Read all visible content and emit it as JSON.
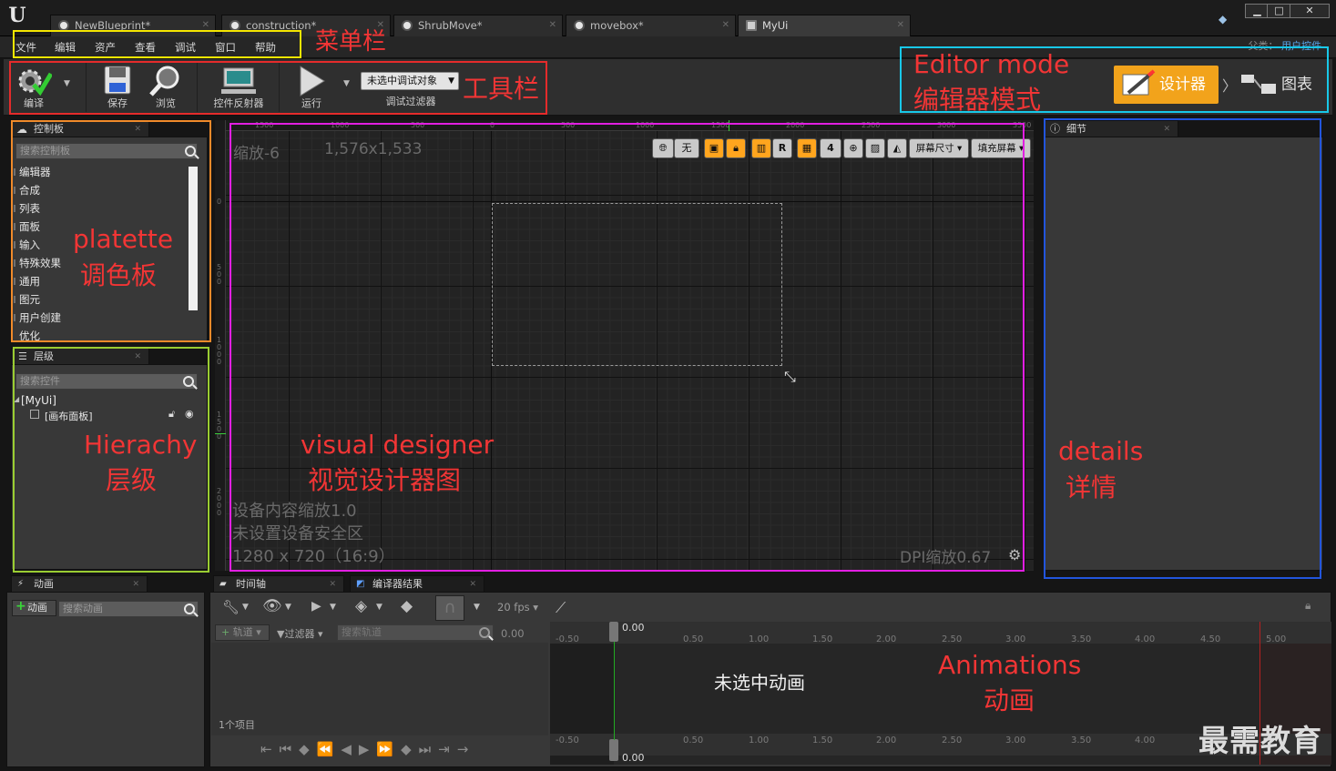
{
  "tabs": [
    {
      "label": "NewBlueprint*"
    },
    {
      "label": "construction*"
    },
    {
      "label": "ShrubMove*"
    },
    {
      "label": "movebox*"
    },
    {
      "label": "MyUi"
    }
  ],
  "menu": [
    "文件",
    "编辑",
    "资产",
    "查看",
    "调试",
    "窗口",
    "帮助"
  ],
  "breadcrumb": {
    "prefix": "父类：",
    "parent": "用户控件"
  },
  "toolbar": {
    "compile": "编译",
    "save": "保存",
    "browse": "浏览",
    "reflector": "控件反射器",
    "run": "运行",
    "debug_select": "未选中调试对象",
    "debug_filter": "调试过滤器"
  },
  "modes": {
    "designer": "设计器",
    "graph": "图表"
  },
  "palette": {
    "title": "控制板",
    "search_placeholder": "搜索控制板",
    "items": [
      "编辑器",
      "合成",
      "列表",
      "面板",
      "输入",
      "特殊效果",
      "通用",
      "图元",
      "用户创建",
      "优化"
    ]
  },
  "hierarchy": {
    "title": "层级",
    "search_placeholder": "搜索控件",
    "root": "[MyUi]",
    "child": "[画布面板]"
  },
  "canvas": {
    "zoom": "缩放-6",
    "size": "1,576x1,533",
    "device_scale": "设备内容缩放1.0",
    "safe_zone": "未设置设备安全区",
    "resolution": "1280 x 720（16:9）",
    "dpi": "DPI缩放0.67",
    "toolbar": {
      "none": "无",
      "r": "R",
      "four": "4",
      "screen_size": "屏幕尺寸",
      "fill_screen": "填充屏幕"
    },
    "ruler_top": [
      "1500",
      "1000",
      "500",
      "0",
      "500",
      "1000",
      "1500",
      "2000",
      "2500",
      "3000",
      "3500"
    ],
    "ruler_left": [
      "0",
      "5\n0\n0",
      "1\n0\n0\n0",
      "1\n5\n0\n0",
      "2\n0\n0\n0"
    ]
  },
  "details": {
    "title": "细节"
  },
  "animations": {
    "title": "动画",
    "add_button": "动画",
    "search_placeholder": "搜索动画"
  },
  "timeline": {
    "tab_timeline": "时间轴",
    "tab_compiler": "编译器结果",
    "fps": "20 fps",
    "track": "轨道",
    "filter": "过滤器",
    "search_placeholder": "搜索轨道",
    "time_value": "0.00",
    "marker_top": "0.00",
    "marker_bottom": "0.00",
    "no_animation": "未选中动画",
    "item_count": "1个项目",
    "ticks": [
      "-0.50",
      "0.50",
      "1.00",
      "1.50",
      "2.00",
      "2.50",
      "3.00",
      "3.50",
      "4.00",
      "4.50",
      "5.00"
    ],
    "ticks_bottom": [
      "-0.50",
      "0.50",
      "1.00",
      "1.50",
      "2.00",
      "2.50",
      "3.00",
      "3.50",
      "4.00"
    ]
  },
  "annotations": {
    "menubar": "菜单栏",
    "toolbar": "工具栏",
    "editor_mode_en": "Editor mode",
    "editor_mode_cn": "编辑器模式",
    "palette_en": "platette",
    "palette_cn": "调色板",
    "hierarchy_en": "Hierachy",
    "hierarchy_cn": "层级",
    "designer_en": "visual designer",
    "designer_cn": "视觉设计器图",
    "details_en": "details",
    "details_cn": "详情",
    "animations_en": "Animations",
    "animations_cn": "动画"
  },
  "watermark": "最需教育",
  "colors": {
    "annotation_red": "#f23535",
    "menubar_outline": "#f5e600",
    "toolbar_outline": "#e52b2b",
    "mode_outline": "#18c8e8",
    "palette_outline": "#f08a2a",
    "hierarchy_outline": "#9acd32",
    "designer_outline": "#e21fe2",
    "details_outline": "#2255dd",
    "designer_button": "#f2a31b"
  }
}
